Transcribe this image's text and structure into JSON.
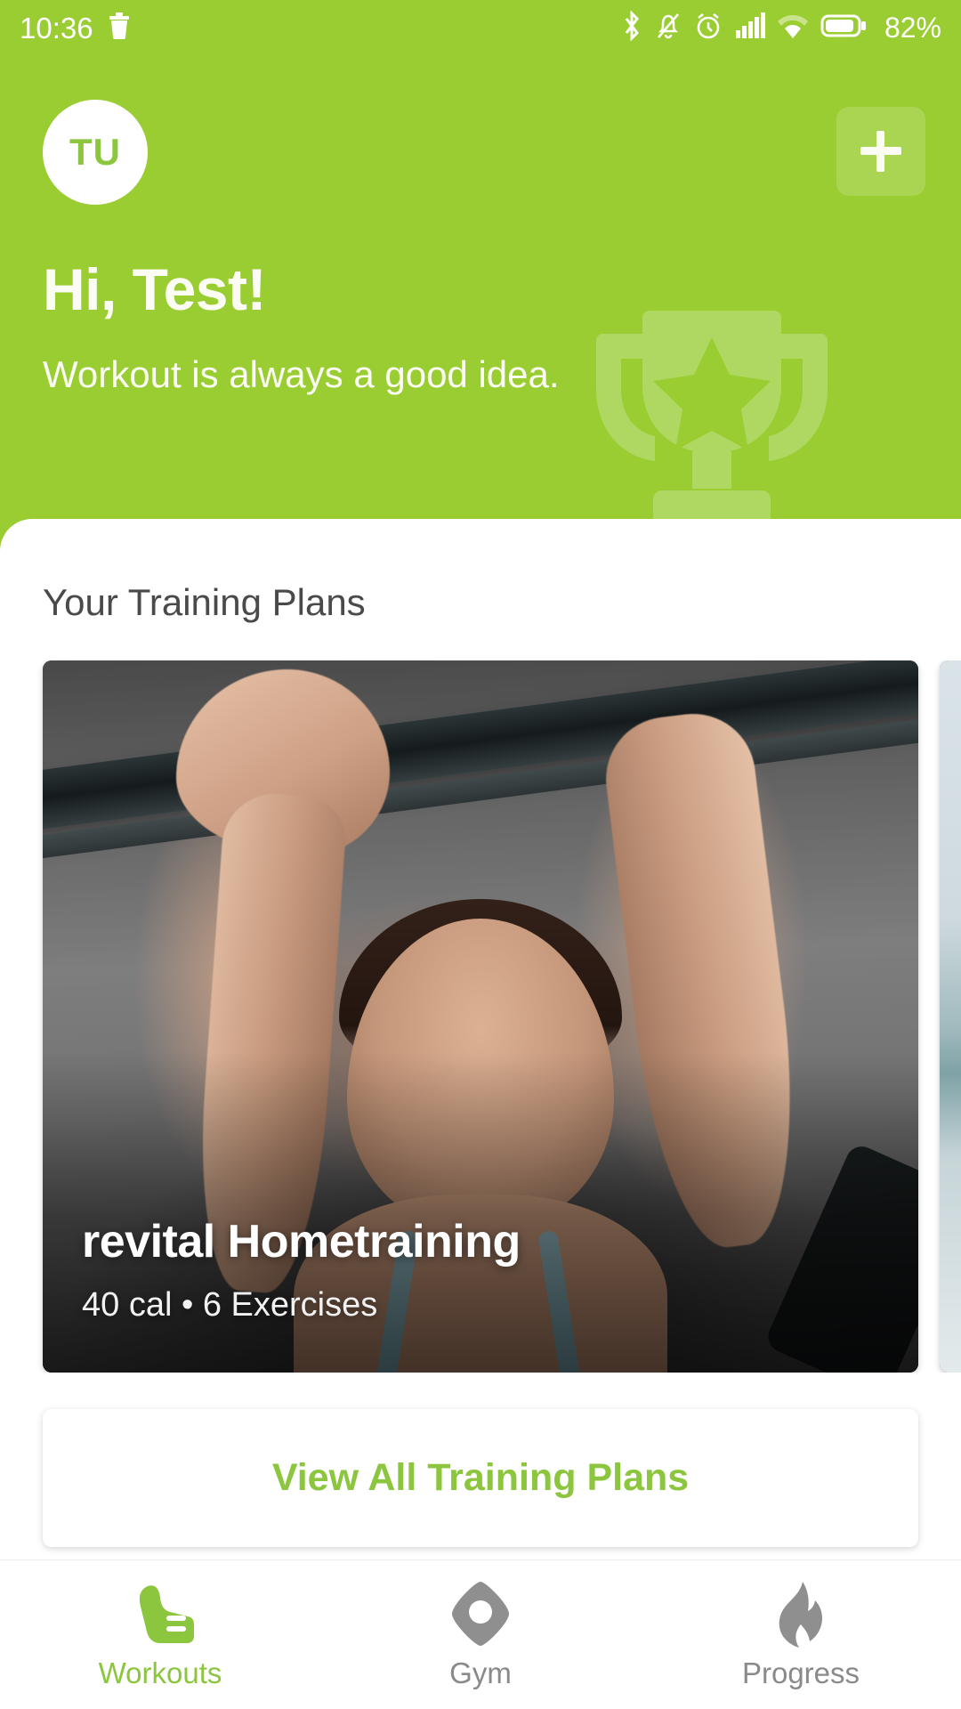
{
  "status_bar": {
    "time": "10:36",
    "battery_percent": "82%",
    "icons": [
      "trash-icon",
      "bluetooth-icon",
      "notifications-muted-icon",
      "alarm-icon",
      "signal-icon",
      "wifi-icon",
      "battery-icon"
    ]
  },
  "header": {
    "avatar_initials": "TU",
    "add_button_label": "+",
    "greeting": "Hi, Test!",
    "subgreeting": "Workout is always a good idea.",
    "background_color": "#9ACD32",
    "watermark_icon": "trophy-icon"
  },
  "main": {
    "section_title": "Your Training Plans",
    "plans": [
      {
        "title": "revital Hometraining",
        "calories": "40 cal",
        "exercises": "6 Exercises",
        "meta": "40 cal • 6 Exercises"
      },
      {
        "title": "",
        "calories": "",
        "exercises": "",
        "meta": ""
      }
    ],
    "view_all_label": "View All Training Plans",
    "accent_color": "#8CC63E"
  },
  "bottom_nav": {
    "items": [
      {
        "label": "Workouts",
        "icon": "running-shoe-icon",
        "active": true
      },
      {
        "label": "Gym",
        "icon": "gym-diamond-icon",
        "active": false
      },
      {
        "label": "Progress",
        "icon": "flame-icon",
        "active": false
      }
    ],
    "active_color": "#8CC63E",
    "inactive_color": "#8a8a8a"
  }
}
